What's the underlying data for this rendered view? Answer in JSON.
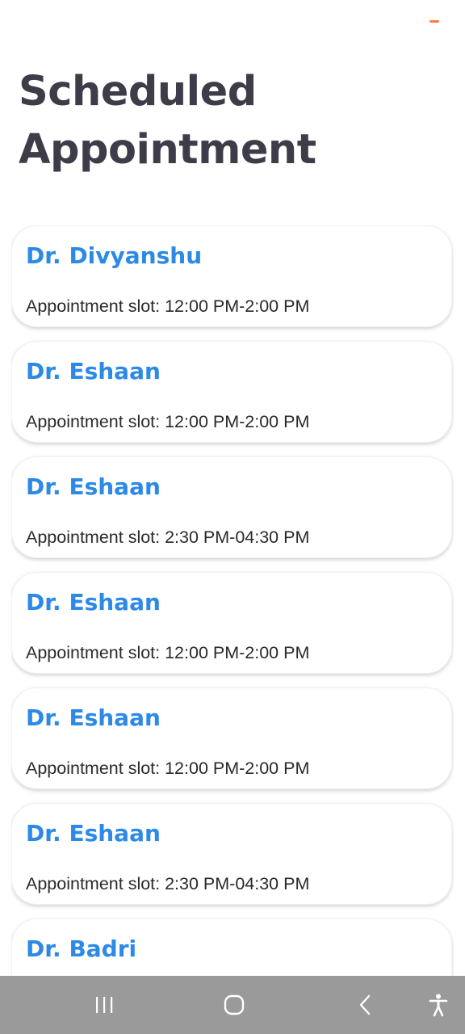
{
  "screen": {
    "title": "Scheduled Appointment",
    "accent_color": "#ff7a45",
    "title_color": "#3d3c48",
    "doctor_name_color": "#2c8ae6"
  },
  "appointments": [
    {
      "doctor": "Dr. Divyanshu",
      "slot": "Appointment slot: 12:00 PM-2:00 PM"
    },
    {
      "doctor": "Dr. Eshaan",
      "slot": "Appointment slot: 12:00 PM-2:00 PM"
    },
    {
      "doctor": "Dr. Eshaan",
      "slot": "Appointment slot: 2:30 PM-04:30 PM"
    },
    {
      "doctor": "Dr. Eshaan",
      "slot": "Appointment slot: 12:00 PM-2:00 PM"
    },
    {
      "doctor": "Dr. Eshaan",
      "slot": "Appointment slot: 12:00 PM-2:00 PM"
    },
    {
      "doctor": "Dr. Eshaan",
      "slot": "Appointment slot: 2:30 PM-04:30 PM"
    },
    {
      "doctor": "Dr. Badri",
      "slot": ""
    }
  ],
  "nav_bar": {
    "background": "#9a9a9a",
    "icons": [
      "recent-apps-icon",
      "home-icon",
      "back-icon",
      "accessibility-icon"
    ]
  }
}
